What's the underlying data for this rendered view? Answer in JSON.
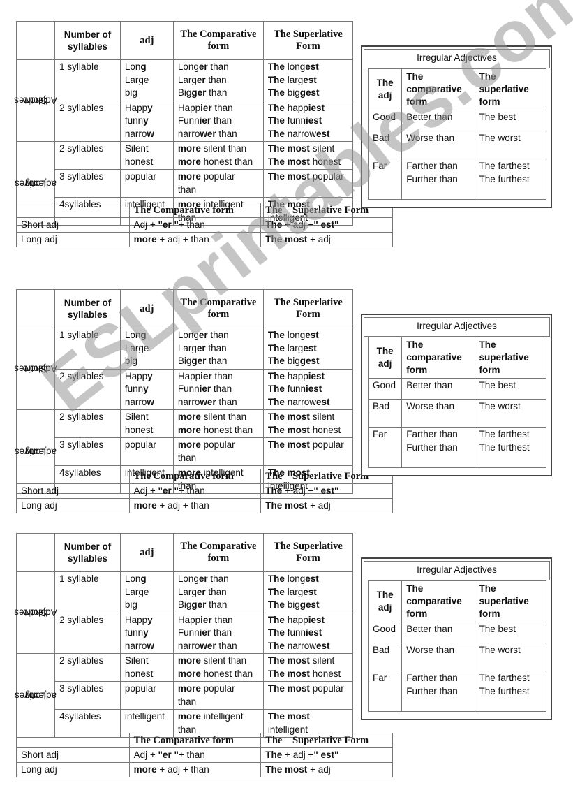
{
  "main_table": {
    "headers": {
      "blank": "",
      "syllables": "Number of syllables",
      "adj": "adj",
      "comparative": "The Comparative form",
      "superlative": "The Superlative Form"
    },
    "groups": [
      {
        "label_line1": "Short",
        "label_line2": "Adjectives",
        "rows": [
          {
            "syllables": "1 syllable",
            "adjs": [
              {
                "base": "Lon",
                "bold": "g"
              },
              {
                "base": "Large",
                "bold": ""
              },
              {
                "base": "big",
                "bold": ""
              }
            ],
            "comparatives": [
              {
                "pre": "",
                "stem": "Long",
                "bold": "er",
                "post": " than"
              },
              {
                "pre": "",
                "stem": "Larg",
                "bold": "er",
                "post": " than"
              },
              {
                "pre": "",
                "stem": "Big",
                "bold": "ger",
                "post": " than"
              }
            ],
            "superlatives": [
              {
                "pre": "The",
                "stem": " long",
                "bold": "est",
                "post": ""
              },
              {
                "pre": "The",
                "stem": " larg",
                "bold": "est",
                "post": ""
              },
              {
                "pre": "The",
                "stem": " big",
                "bold": "gest",
                "post": ""
              }
            ]
          },
          {
            "syllables": "2 syllables",
            "adjs": [
              {
                "base": "Happ",
                "bold": "y"
              },
              {
                "base": "funn",
                "bold": "y"
              },
              {
                "base": "narro",
                "bold": "w"
              }
            ],
            "comparatives": [
              {
                "pre": "",
                "stem": "Happ",
                "bold": "ier",
                "post": " than"
              },
              {
                "pre": "",
                "stem": "Funn",
                "bold": "ier",
                "post": " than"
              },
              {
                "pre": "",
                "stem": "narro",
                "bold": "wer",
                "post": " than"
              }
            ],
            "superlatives": [
              {
                "pre": "The",
                "stem": " happ",
                "bold": "iest",
                "post": ""
              },
              {
                "pre": "The",
                "stem": " funn",
                "bold": "iest",
                "post": ""
              },
              {
                "pre": "The",
                "stem": " narrow",
                "bold": "est",
                "post": ""
              }
            ]
          }
        ]
      },
      {
        "label_line1": "Long",
        "label_line2": "adjectives",
        "rows": [
          {
            "syllables": "2 syllables",
            "adjs": [
              {
                "base": "Silent",
                "bold": ""
              },
              {
                "base": "honest",
                "bold": ""
              }
            ],
            "comparatives": [
              {
                "pre": "more",
                "stem": " silent than",
                "bold": "",
                "post": ""
              },
              {
                "pre": "more",
                "stem": " honest than",
                "bold": "",
                "post": ""
              }
            ],
            "superlatives": [
              {
                "pre": "The most",
                "stem": " silent",
                "bold": "",
                "post": ""
              },
              {
                "pre": "The most",
                "stem": " honest",
                "bold": "",
                "post": ""
              }
            ]
          },
          {
            "syllables": "3 syllables",
            "adjs": [
              {
                "base": "popular",
                "bold": ""
              }
            ],
            "comparatives": [
              {
                "pre": "more",
                "stem": " popular",
                "bold": "",
                "post": ""
              },
              {
                "pre": "",
                "stem": "than",
                "bold": "",
                "post": ""
              }
            ],
            "superlatives": [
              {
                "pre": "The most",
                "stem": " popular",
                "bold": "",
                "post": ""
              }
            ]
          },
          {
            "syllables": "4syllables",
            "adjs": [
              {
                "base": "intelligent",
                "bold": ""
              }
            ],
            "comparatives": [
              {
                "pre": "more",
                "stem": " intelligent",
                "bold": "",
                "post": ""
              },
              {
                "pre": "",
                "stem": "than",
                "bold": "",
                "post": ""
              }
            ],
            "superlatives": [
              {
                "pre": "The most",
                "stem": "",
                "bold": "",
                "post": ""
              },
              {
                "pre": "",
                "stem": "intelligent",
                "bold": "",
                "post": ""
              }
            ]
          }
        ]
      }
    ]
  },
  "formula_table": {
    "headers": [
      "",
      "The Comparative form",
      "The    Superlative Form"
    ],
    "rows": [
      {
        "label": "Short adj",
        "comparative": {
          "a": "Adj + ",
          "b": "\"er \"",
          "c": "+ than"
        },
        "superlative": {
          "a": "The",
          "b": " + adj +",
          "c": "\" est\""
        }
      },
      {
        "label": "Long adj",
        "comparative": {
          "a": "more",
          "b": " + adj + than",
          "c": ""
        },
        "superlative": {
          "a": "The most",
          "b": " + adj",
          "c": ""
        }
      }
    ]
  },
  "irregular_table": {
    "title": "Irregular Adjectives",
    "headers": [
      "The adj",
      "The comparative form",
      "The superlative form"
    ],
    "rows": [
      {
        "adj": "Good",
        "comparative": [
          "Better than"
        ],
        "superlative": [
          "The best"
        ]
      },
      {
        "adj": "Bad",
        "comparative": [
          "Worse than"
        ],
        "superlative": [
          "The worst"
        ]
      },
      {
        "adj": "Far",
        "comparative": [
          "Farther than",
          "Further than"
        ],
        "superlative": [
          "The farthest",
          "The furthest"
        ]
      }
    ]
  },
  "watermark": "ESLprintables.com"
}
